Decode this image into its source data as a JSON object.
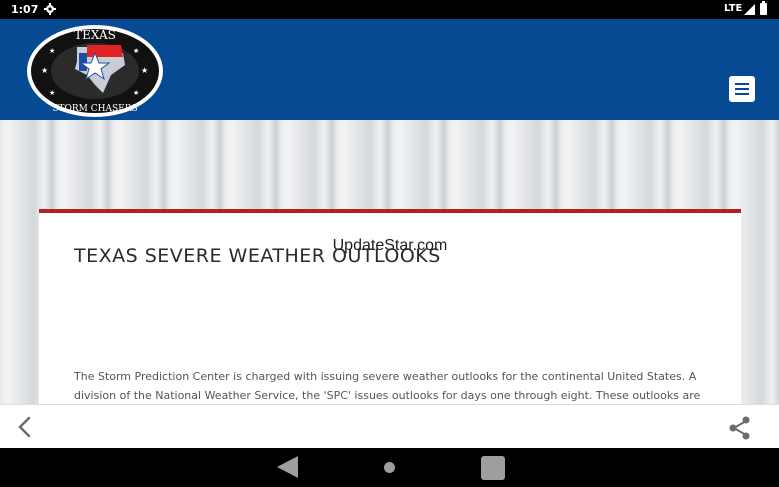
{
  "status_bar": {
    "time": "1:07",
    "network": "LTE"
  },
  "header": {
    "logo_text_top": "TEXAS",
    "logo_text_bottom": "STORM CHASERS",
    "background_color": "#064a94"
  },
  "watermark": "UpdateStar.com",
  "article": {
    "title": "TEXAS SEVERE WEATHER OUTLOOKS",
    "body": "The Storm Prediction Center is charged with issuing severe weather outlooks for the continental United States. A division of the National Weather Service, the 'SPC' issues outlooks for days one through eight. These outlooks are used",
    "accent_color": "#b61f24"
  },
  "icons": {
    "menu": "hamburger-menu-icon",
    "back": "chevron-left-icon",
    "share": "share-icon",
    "settings": "gear-icon"
  }
}
